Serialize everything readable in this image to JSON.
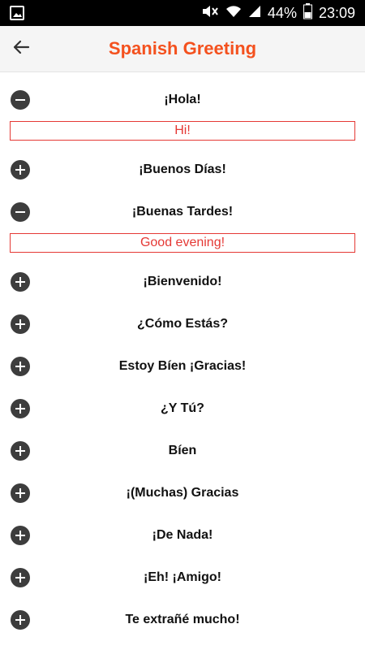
{
  "status_bar": {
    "battery": "44%",
    "time": "23:09",
    "icons": [
      "gallery-icon",
      "mute-icon",
      "wifi-icon",
      "signal-icon",
      "battery-icon"
    ]
  },
  "app_bar": {
    "title": "Spanish Greeting",
    "back_icon": "arrow-back-icon",
    "title_color": "#f4511e"
  },
  "colors": {
    "accent": "#f4511e",
    "translation_border": "#e53935",
    "toggle": "#3d3d3d"
  },
  "phrases": [
    {
      "text": "¡Hola!",
      "expanded": true,
      "translation": "Hi!"
    },
    {
      "text": "¡Buenos Días!",
      "expanded": false
    },
    {
      "text": "¡Buenas Tardes!",
      "expanded": true,
      "translation": "Good evening!"
    },
    {
      "text": "¡Bienvenido!",
      "expanded": false
    },
    {
      "text": "¿Cómo Estás?",
      "expanded": false
    },
    {
      "text": "Estoy Bíen ¡Gracias!",
      "expanded": false
    },
    {
      "text": "¿Y Tú?",
      "expanded": false
    },
    {
      "text": "Bíen",
      "expanded": false
    },
    {
      "text": "¡(Muchas) Gracias",
      "expanded": false
    },
    {
      "text": "¡De Nada!",
      "expanded": false
    },
    {
      "text": "¡Eh! ¡Amigo!",
      "expanded": false
    },
    {
      "text": "Te extrañé mucho!",
      "expanded": false
    }
  ]
}
